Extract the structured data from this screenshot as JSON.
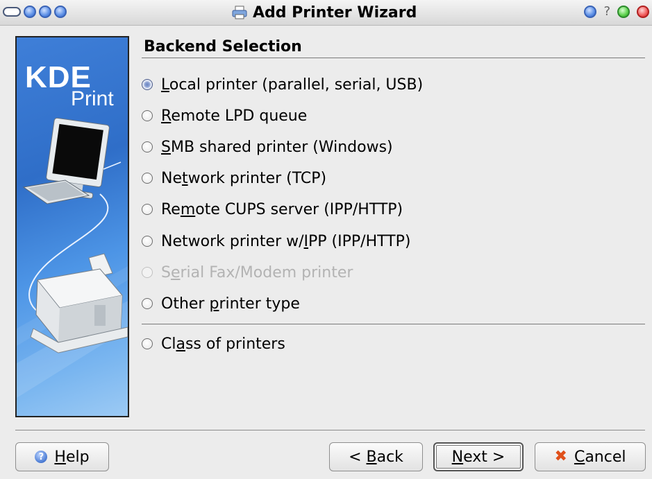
{
  "window": {
    "title": "Add Printer Wizard",
    "title_icon": "printer-icon"
  },
  "banner": {
    "logo_main": "KDE",
    "logo_sub": "Print",
    "illustration": "computer-and-printer"
  },
  "page": {
    "section_title": "Backend Selection"
  },
  "options": [
    {
      "pre": "",
      "mn": "L",
      "post": "ocal printer (parallel, serial, USB)",
      "checked": true,
      "enabled": true
    },
    {
      "pre": "",
      "mn": "R",
      "post": "emote LPD queue",
      "checked": false,
      "enabled": true
    },
    {
      "pre": "",
      "mn": "S",
      "post": "MB shared printer (Windows)",
      "checked": false,
      "enabled": true
    },
    {
      "pre": "Ne",
      "mn": "t",
      "post": "work printer (TCP)",
      "checked": false,
      "enabled": true
    },
    {
      "pre": "Re",
      "mn": "m",
      "post": "ote CUPS server (IPP/HTTP)",
      "checked": false,
      "enabled": true
    },
    {
      "pre": "Network printer w/",
      "mn": "I",
      "post": "PP (IPP/HTTP)",
      "checked": false,
      "enabled": true
    },
    {
      "pre": "S",
      "mn": "e",
      "post": "rial Fax/Modem printer",
      "checked": false,
      "enabled": false
    },
    {
      "pre": "Other ",
      "mn": "p",
      "post": "rinter type",
      "checked": false,
      "enabled": true
    },
    {
      "pre": "Cl",
      "mn": "a",
      "post": "ss of printers",
      "checked": false,
      "enabled": true
    }
  ],
  "buttons": {
    "help": {
      "pre": "",
      "mn": "H",
      "post": "elp"
    },
    "back": {
      "pre": "< ",
      "mn": "B",
      "post": "ack"
    },
    "next": {
      "pre": "",
      "mn": "N",
      "post": "ext >"
    },
    "cancel": {
      "pre": "",
      "mn": "C",
      "post": "ancel"
    }
  },
  "colors": {
    "banner_blue": "#3f7fd8",
    "cancel_icon": "#e0501a",
    "help_icon": "#4f7fd6"
  }
}
